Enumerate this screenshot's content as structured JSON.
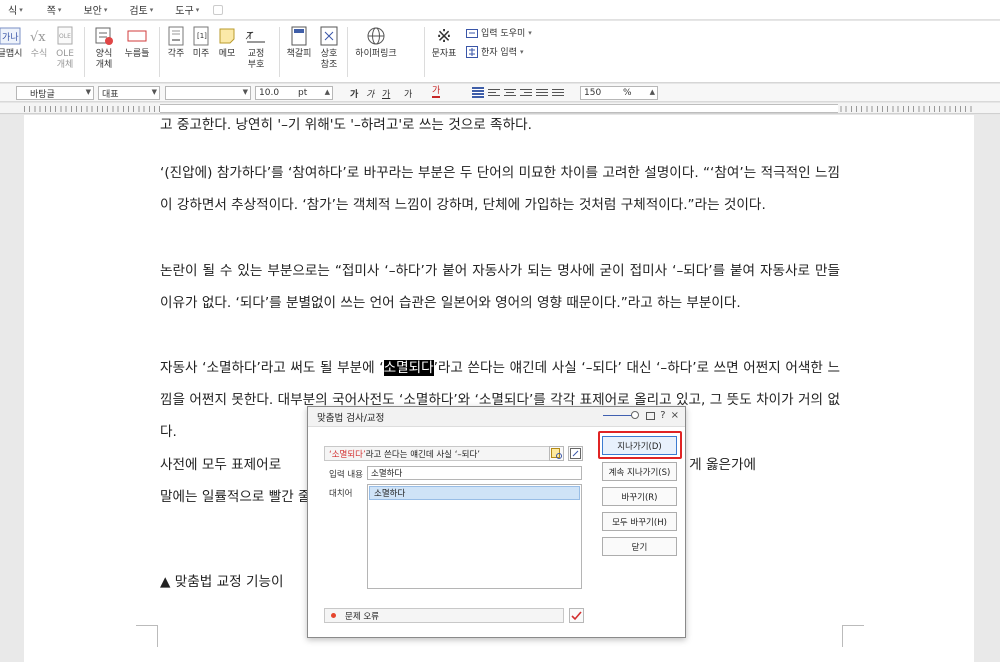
{
  "menubar": {
    "items": [
      {
        "label": "식",
        "caret": "▾"
      },
      {
        "label": "쪽",
        "caret": "▾"
      },
      {
        "label": "보안",
        "caret": "▾"
      },
      {
        "label": "검토",
        "caret": "▾"
      },
      {
        "label": "도구",
        "caret": "▾"
      }
    ]
  },
  "ribbon": {
    "clip_label": "글맵시",
    "math_label": "수식",
    "ole_label": "OLE",
    "ole_label2": "개체",
    "form_label": "양식",
    "form_label2": "개체",
    "pushbtn_label": "누름틀",
    "footnote_label": "각주",
    "endnote_label": "미주",
    "memo_label": "메모",
    "revision_label": "교정",
    "revision_label2": "부호",
    "bookmark_label": "책갈피",
    "crossref_label": "상호",
    "crossref_label2": "참조",
    "hyperlink_label": "하이퍼링크",
    "symbol_label": "문자표",
    "input_helper": "입력 도우미",
    "hanja_input": "한자 입력"
  },
  "format": {
    "style": "바탕글",
    "font_lang": "대표",
    "font_name": "",
    "font_size": "10.0",
    "unit": "pt",
    "bold": "가",
    "italic": "가",
    "underline": "가",
    "strike": "가",
    "color": "가",
    "zoom": "150",
    "zoom_unit": "%"
  },
  "document": {
    "line0": "고 중고한다. 낭연히 '–기 위해'도 '–하려고'로 쓰는 것으로 족하다.",
    "p1": "‘(진압에) 참가하다’를 ‘참여하다’로 바꾸라는 부분은 두 단어의 미묘한 차이를 고려한 설명이다. “‘참여’는 적극적인 느낌이 강하면서 추상적이다. ‘참가’는 객체적 느낌이 강하며, 단체에 가입하는 것처럼 구체적이다.”라는 것이다.",
    "p2": "논란이 될 수 있는 부분으로는 “접미사 ‘–하다’가 붙어 자동사가 되는 명사에 굳이 접미사 ‘–되다’를 붙여 자동사로 만들 이유가 없다. ‘되다’를 분별없이 쓰는 언어 습관은 일본어와 영어의 영향 때문이다.”라고 하는 부분이다.",
    "p3_before": "자동사 ‘소멸하다’라고 써도 될 부분에 ‘",
    "p3_highlight": "소멸되다",
    "p3_after": "’라고 쓴다는 얘긴데 사실 ‘–되다’ 대신 ‘–하다’로 쓰면 어쩐지 어색한 느낌을 어쩐지 못한다. 대부분의 국어사전도 ‘소멸하다’와 ‘소멸되다’를 각각 표제어로 올리고 있고, 그 뜻도                                              차이가 거의 없다.",
    "p4": "사전에 모두 표제어로                                                       굳이 ‘–하다’의 형식으로 쓰는 게 옳은가에                                                       말에는 일률적으로 빨간 줄이 그어지면서 위의",
    "caption": "▲ 맞춤법 교정 기능이"
  },
  "dialog": {
    "title": "맞춤법 검사/교정",
    "sentence_error": "‘소멸되다’",
    "sentence_rest": "라고 쓴다는 얘긴데 사실 ‘–되다’",
    "input_label": "입력 내용",
    "input_value": "소멸하다",
    "replace_label": "대치어",
    "suggestions": [
      "소멸하다"
    ],
    "status_text": "문제 오류",
    "buttons": {
      "skip": "지나가기(D)",
      "skip_all": "계속 지나가기(S)",
      "replace": "바꾸기(R)",
      "replace_all": "모두 바꾸기(H)",
      "close": "닫기"
    },
    "ctrl_help": "?",
    "ctrl_close": "×"
  }
}
